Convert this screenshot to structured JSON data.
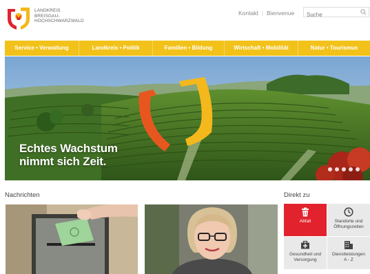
{
  "header": {
    "logo_text": [
      "LANDKREIS",
      "BREISGAU-",
      "HOCHSCHWARZWALD"
    ],
    "meta_links": [
      "Kontakt",
      "Bienvenue"
    ],
    "search_placeholder": "Suche"
  },
  "nav": {
    "items": [
      {
        "label": "Service • Verwaltung"
      },
      {
        "label": "Landkreis • Politik"
      },
      {
        "label": "Familien • Bildung"
      },
      {
        "label": "Wirtschaft • Mobilität"
      },
      {
        "label": "Natur • Tourismus"
      }
    ]
  },
  "hero": {
    "caption_line1": "Echtes Wachstum",
    "caption_line2": "nimmt sich Zeit.",
    "slide_count": 5
  },
  "sections": {
    "news_title": "Nachrichten",
    "direct_title": "Direkt zu"
  },
  "direct_links": [
    {
      "label_line1": "Abfall",
      "label_line2": "",
      "icon": "trash-icon"
    },
    {
      "label_line1": "Standorte und",
      "label_line2": "Öffnungszeiten",
      "icon": "clock-icon"
    },
    {
      "label_line1": "Gesundheit und",
      "label_line2": "Versorgung",
      "icon": "medical-kit-icon"
    },
    {
      "label_line1": "Dienstleistungen",
      "label_line2": "A - Z",
      "icon": "building-icon"
    }
  ],
  "colors": {
    "nav_yellow": "#f2c21a",
    "accent_red": "#e2232d",
    "logo_orange": "#e8561f",
    "logo_yellow": "#f4b81c"
  }
}
